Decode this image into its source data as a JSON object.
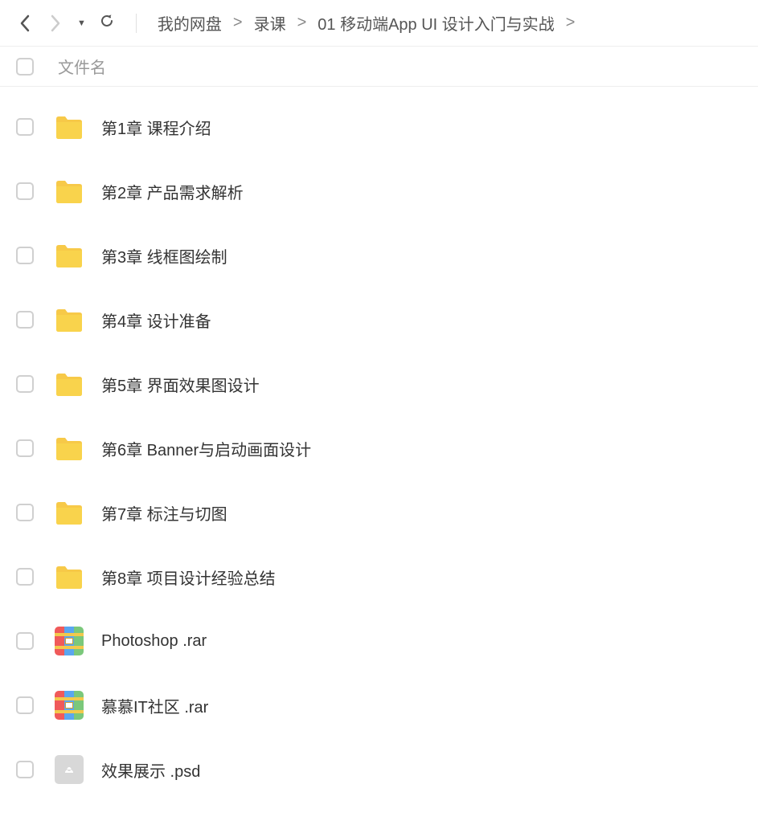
{
  "breadcrumb": {
    "items": [
      "我的网盘",
      "录课",
      "01 移动端App UI 设计入门与实战"
    ]
  },
  "header": {
    "col_name": "文件名"
  },
  "files": [
    {
      "type": "folder",
      "name": "第1章 课程介绍"
    },
    {
      "type": "folder",
      "name": "第2章 产品需求解析"
    },
    {
      "type": "folder",
      "name": "第3章 线框图绘制"
    },
    {
      "type": "folder",
      "name": "第4章 设计准备"
    },
    {
      "type": "folder",
      "name": "第5章 界面效果图设计"
    },
    {
      "type": "folder",
      "name": "第6章 Banner与启动画面设计"
    },
    {
      "type": "folder",
      "name": "第7章 标注与切图"
    },
    {
      "type": "folder",
      "name": "第8章 项目设计经验总结"
    },
    {
      "type": "rar",
      "name": "Photoshop .rar"
    },
    {
      "type": "rar",
      "name": "慕慕IT社区 .rar"
    },
    {
      "type": "psd",
      "name": "效果展示 .psd"
    }
  ]
}
